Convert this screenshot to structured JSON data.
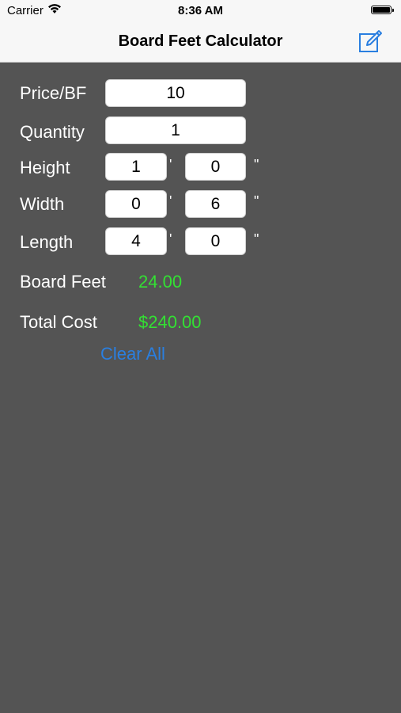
{
  "status_bar": {
    "carrier": "Carrier",
    "time": "8:36 AM",
    "wifi_icon": "wifi-icon",
    "battery_icon": "battery-icon"
  },
  "nav_bar": {
    "title": "Board Feet Calculator",
    "compose_icon": "compose-icon"
  },
  "form": {
    "price": {
      "label": "Price/BF",
      "value": "10"
    },
    "quantity": {
      "label": "Quantity",
      "value": "1"
    },
    "height": {
      "label": "Height",
      "feet": "1",
      "inches": "0"
    },
    "width": {
      "label": "Width",
      "feet": "0",
      "inches": "6"
    },
    "length": {
      "label": "Length",
      "feet": "4",
      "inches": "0"
    },
    "feet_mark": "'",
    "inch_mark": "\""
  },
  "results": {
    "board_feet": {
      "label": "Board Feet",
      "value": "24.00"
    },
    "total_cost": {
      "label": "Total Cost",
      "value": "$240.00"
    }
  },
  "actions": {
    "clear_all": "Clear All"
  },
  "colors": {
    "background": "#545454",
    "result_green": "#33e033",
    "link_blue": "#2a7fe0",
    "bar_bg": "#f7f7f7"
  }
}
